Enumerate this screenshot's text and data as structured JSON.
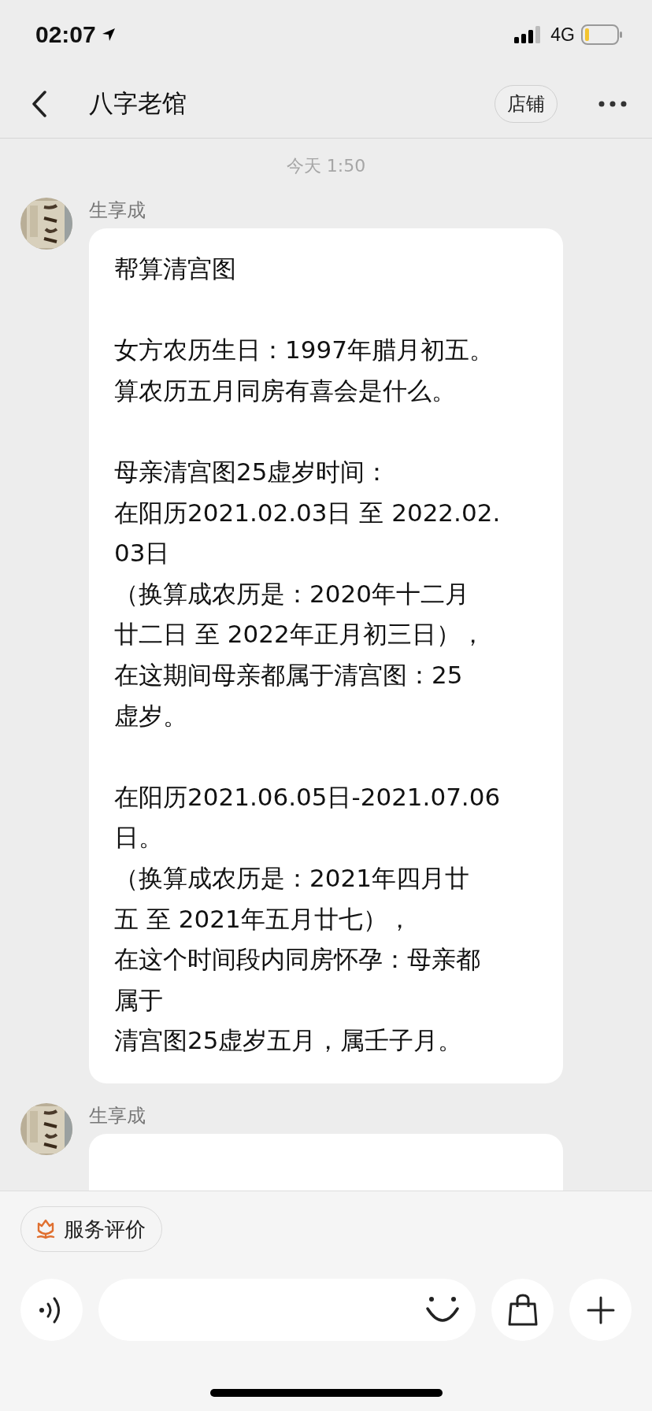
{
  "status_bar": {
    "time": "02:07",
    "network": "4G"
  },
  "nav": {
    "title": "八字老馆",
    "store_button": "店铺"
  },
  "chat": {
    "timestamp": "今天 1:50",
    "messages": [
      {
        "sender": "生享成",
        "paragraphs": [
          [
            "帮算清宫图"
          ],
          [
            "女方农历生日：1997年腊月初五。",
            "算农历五月同房有喜会是什么。"
          ],
          [
            "母亲清宫图25虚岁时间：",
            "在阳历2021.02.03日 至 2022.02.",
            "03日",
            "（换算成农历是：2020年十二月",
            "廿二日 至 2022年正月初三日），",
            "在这期间母亲都属于清宫图：25",
            "虚岁。"
          ],
          [
            "在阳历2021.06.05日-2021.07.06",
            "日。",
            "（换算成农历是：2021年四月廿",
            "五 至 2021年五月廿七），",
            "在这个时间段内同房怀孕：母亲都",
            "属于",
            "清宫图25虚岁五月，属壬子月。"
          ]
        ]
      },
      {
        "sender": "生享成"
      }
    ]
  },
  "footer": {
    "review_button": "服务评价"
  }
}
